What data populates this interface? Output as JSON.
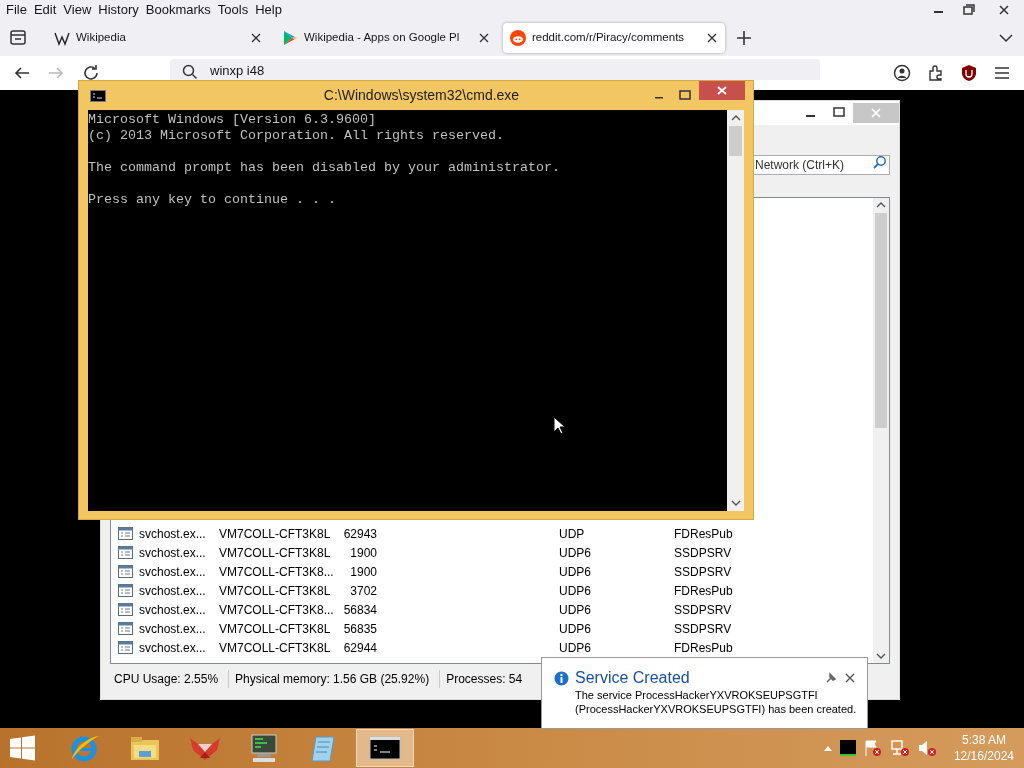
{
  "browser": {
    "menu": [
      "File",
      "Edit",
      "View",
      "History",
      "Bookmarks",
      "Tools",
      "Help"
    ],
    "tabs": [
      {
        "kind": "wiki",
        "label": "Wikipedia",
        "selected": false
      },
      {
        "kind": "play",
        "label": "Wikipedia - Apps on Google Pl",
        "selected": false
      },
      {
        "kind": "reddit",
        "label": "reddit.com/r/Piracy/comments",
        "selected": true
      }
    ],
    "address": "winxp i48"
  },
  "process_window": {
    "search": {
      "placeholder": "Network (Ctrl+K)"
    },
    "rows": [
      {
        "process": "svchost.ex...",
        "local_host": "VM7COLL-CFT3K8L",
        "local_port": "62943",
        "protocol": "UDP",
        "service": "FDResPub"
      },
      {
        "process": "svchost.ex...",
        "local_host": "VM7COLL-CFT3K8L",
        "local_port": "1900",
        "protocol": "UDP6",
        "service": "SSDPSRV"
      },
      {
        "process": "svchost.ex...",
        "local_host": "VM7COLL-CFT3K8...",
        "local_port": "1900",
        "protocol": "UDP6",
        "service": "SSDPSRV"
      },
      {
        "process": "svchost.ex...",
        "local_host": "VM7COLL-CFT3K8L",
        "local_port": "3702",
        "protocol": "UDP6",
        "service": "FDResPub"
      },
      {
        "process": "svchost.ex...",
        "local_host": "VM7COLL-CFT3K8...",
        "local_port": "56834",
        "protocol": "UDP6",
        "service": "SSDPSRV"
      },
      {
        "process": "svchost.ex...",
        "local_host": "VM7COLL-CFT3K8L",
        "local_port": "56835",
        "protocol": "UDP6",
        "service": "SSDPSRV"
      },
      {
        "process": "svchost.ex...",
        "local_host": "VM7COLL-CFT3K8L",
        "local_port": "62944",
        "protocol": "UDP6",
        "service": "FDResPub"
      }
    ],
    "status_bar": [
      "CPU Usage: 2.55%",
      "Physical memory: 1.56 GB (25.92%)",
      "Processes: 54"
    ]
  },
  "cmd_window": {
    "title": "C:\\Windows\\system32\\cmd.exe",
    "paragraphs": [
      [
        "Microsoft Windows [Version 6.3.9600]",
        "(c) 2013 Microsoft Corporation. All rights reserved."
      ],
      [
        "The command prompt has been disabled by your administrator."
      ],
      [
        "Press any key to continue . . ."
      ]
    ]
  },
  "notification": {
    "title": "Service Created",
    "message": "The service ProcessHackerYXVROKSEUPSGTFI (ProcessHackerYXVROKSEUPSGTFI) has been created."
  },
  "taskbar": {
    "apps": [
      {
        "kind": "ie",
        "selected": false
      },
      {
        "kind": "explorer",
        "selected": false
      },
      {
        "kind": "fox",
        "selected": false
      },
      {
        "kind": "monitor",
        "selected": false
      },
      {
        "kind": "notepad",
        "selected": false
      },
      {
        "kind": "cmd",
        "selected": true
      }
    ],
    "time": "5:38 AM",
    "date": "12/16/2024"
  }
}
